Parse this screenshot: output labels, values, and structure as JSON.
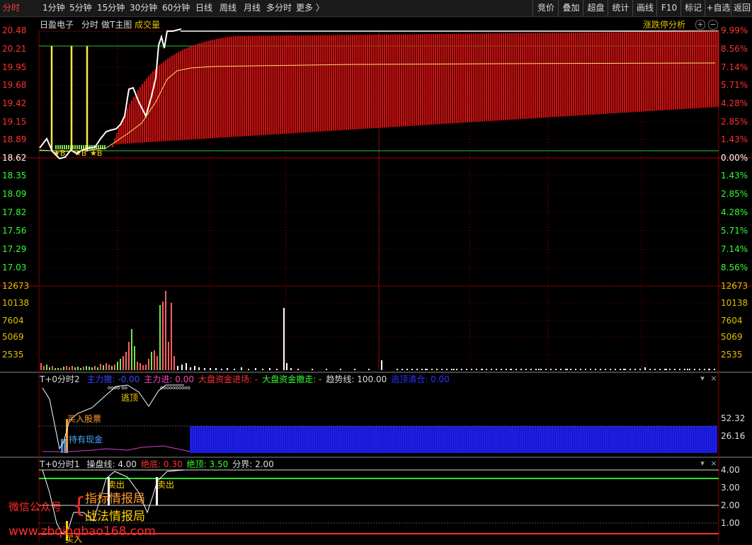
{
  "tabs": [
    "分时",
    "1分钟",
    "5分钟",
    "15分钟",
    "30分钟",
    "60分钟",
    "日线",
    "周线",
    "月线",
    "多分时",
    "更多 〉"
  ],
  "active_tab": 0,
  "right_tabs": [
    "竞价",
    "叠加",
    "超盘",
    "统计",
    "画线",
    "F10",
    "标记",
    "+自选",
    "返回"
  ],
  "header": {
    "stock_name": "日盈电子",
    "mode": "分时",
    "indicator": "做T主图",
    "volume_label": "成交量",
    "limit_analysis": "涨跌停分析"
  },
  "left_axis": [
    "20.48",
    "20.21",
    "19.95",
    "19.68",
    "19.42",
    "19.15",
    "18.89",
    "18.62",
    "18.35",
    "18.09",
    "17.82",
    "17.56",
    "17.29",
    "17.03"
  ],
  "right_axis": [
    "9.99%",
    "8.56%",
    "7.14%",
    "5.71%",
    "4.28%",
    "2.85%",
    "1.43%",
    "0.00%",
    "1.43%",
    "2.85%",
    "4.28%",
    "5.71%",
    "7.14%",
    "8.56%"
  ],
  "volume_axis": [
    "12673",
    "10138",
    "7604",
    "5069",
    "2535"
  ],
  "signals": {
    "b_marks": [
      "B",
      "B",
      "B"
    ]
  },
  "sub1": {
    "title": "T+0分时2",
    "items": [
      {
        "label": "主力撤:",
        "value": "-0.00",
        "color": "#3f3fff"
      },
      {
        "label": "主力进:",
        "value": "0.00",
        "color": "#ff3fbf"
      },
      {
        "label": "大盘资金进场:",
        "value": "-",
        "color": "#ff3030"
      },
      {
        "label": "大盘资金撤走:",
        "value": "-",
        "color": "#30ff30"
      },
      {
        "label": "趋势线:",
        "value": "100.00",
        "color": "#dddddd"
      },
      {
        "label": "逃顶清仓:",
        "value": "0.00",
        "color": "#3030ff"
      }
    ],
    "axis": [
      "52.32",
      "26.16"
    ],
    "annotations": {
      "top": "逃顶",
      "buy": "买入股票",
      "hold": "持有现金"
    }
  },
  "sub2": {
    "title": "T+0分时1",
    "items": [
      {
        "label": "操盘线:",
        "value": "4.00",
        "color": "#dddddd"
      },
      {
        "label": "绝底:",
        "value": "0.30",
        "color": "#ff3030"
      },
      {
        "label": "绝顶:",
        "value": "3.50",
        "color": "#30ff30"
      },
      {
        "label": "分界:",
        "value": "2.00",
        "color": "#dddddd"
      }
    ],
    "axis": [
      "4.00",
      "3.00",
      "2.00",
      "1.00"
    ],
    "annotations": {
      "sell1": "卖出",
      "sell2": "卖出",
      "buy": "买入"
    }
  },
  "watermark": {
    "line1": "微信公众号",
    "line2": "指标情报局",
    "line3": "战法情报局",
    "url": "www.zbqingbao168.com"
  }
}
